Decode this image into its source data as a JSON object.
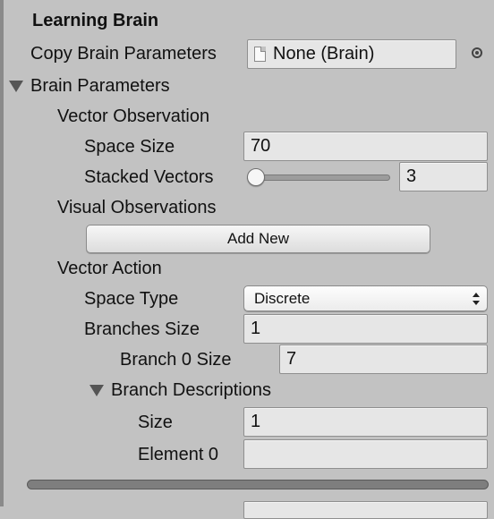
{
  "header": {
    "title": "Learning Brain"
  },
  "copy_brain": {
    "label": "Copy Brain Parameters",
    "value": "None (Brain)",
    "object_icon": "object-icon",
    "picker_icon": "object-picker-icon"
  },
  "brain_parameters": {
    "label": "Brain Parameters",
    "expanded": true,
    "vector_observation": {
      "label": "Vector Observation",
      "space_size": {
        "label": "Space Size",
        "value": "70"
      },
      "stacked_vectors": {
        "label": "Stacked Vectors",
        "value": "3",
        "slider_fraction": 0.05
      }
    },
    "visual_observations": {
      "label": "Visual Observations",
      "add_new_label": "Add New"
    },
    "vector_action": {
      "label": "Vector Action",
      "space_type": {
        "label": "Space Type",
        "value": "Discrete"
      },
      "branches_size": {
        "label": "Branches Size",
        "value": "1"
      },
      "branch_0_size": {
        "label": "Branch 0 Size",
        "value": "7"
      },
      "branch_descriptions": {
        "label": "Branch Descriptions",
        "expanded": true,
        "size": {
          "label": "Size",
          "value": "1"
        },
        "element_0": {
          "label": "Element 0",
          "value": ""
        }
      }
    }
  },
  "colors": {
    "panel_bg": "#c2c2c2",
    "field_bg": "#e6e6e6",
    "text": "#111111"
  }
}
